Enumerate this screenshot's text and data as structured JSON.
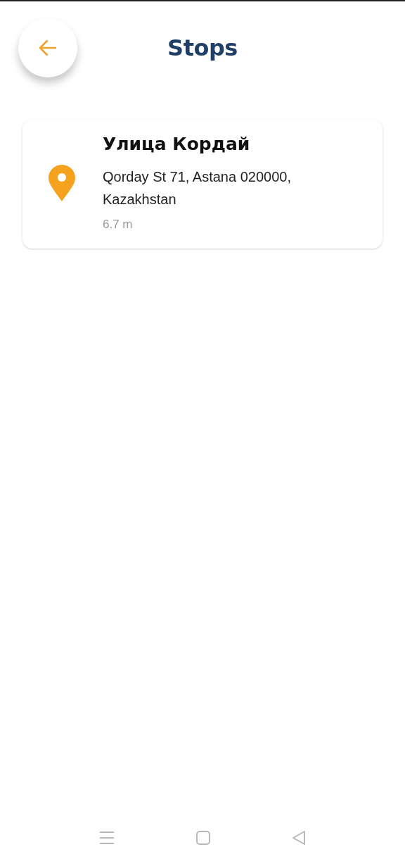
{
  "header": {
    "title": "Stops"
  },
  "stops": [
    {
      "name": "Улица Кордай",
      "address": "Qorday St 71, Astana 020000, Kazakhstan",
      "distance": "6.7 m"
    }
  ]
}
